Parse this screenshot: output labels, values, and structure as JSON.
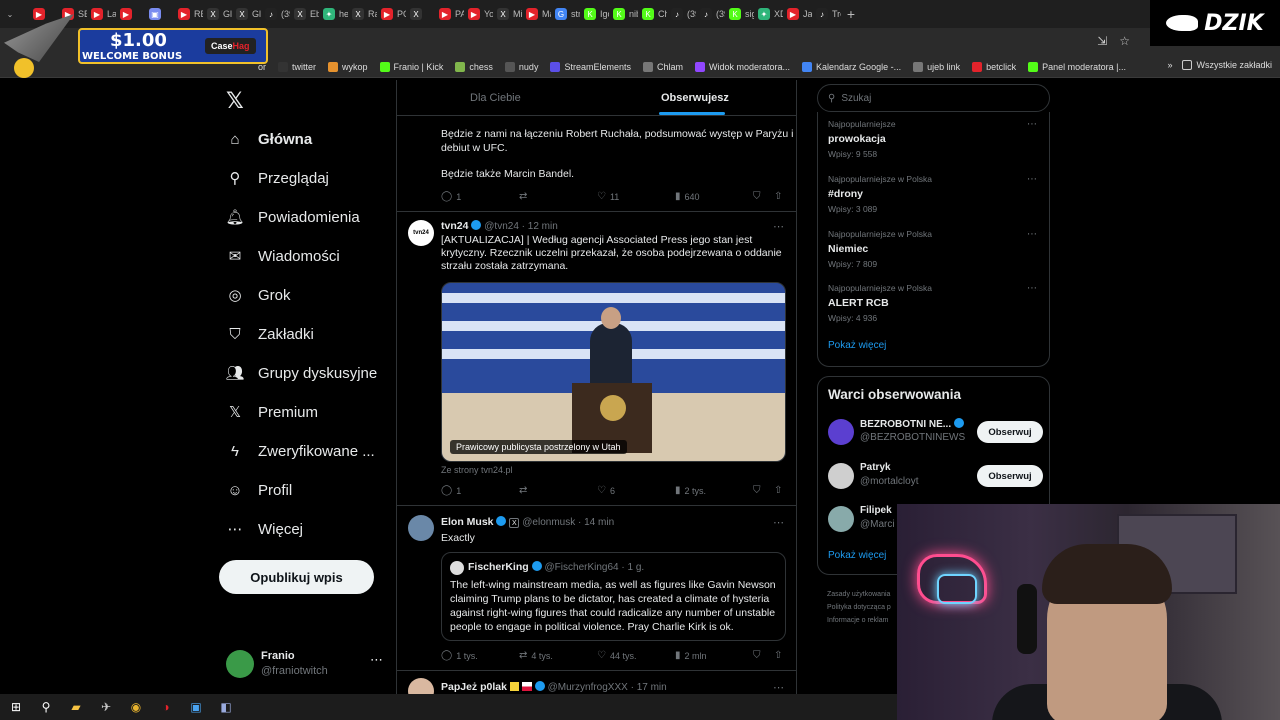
{
  "browser": {
    "tabs": [
      {
        "label": "",
        "color": "#e3232b",
        "glyph": "▶"
      },
      {
        "label": "SB",
        "color": "#e3232b",
        "glyph": "▶"
      },
      {
        "label": "Lau",
        "color": "#e3232b",
        "glyph": "▶"
      },
      {
        "label": "",
        "color": "#e3232b",
        "glyph": "▶"
      },
      {
        "label": "",
        "color": "#7a8cf0",
        "glyph": "▣"
      },
      {
        "label": "REI",
        "color": "#e3232b",
        "glyph": "▶"
      },
      {
        "label": "Glo",
        "color": "#333",
        "glyph": "X"
      },
      {
        "label": "Glo",
        "color": "#333",
        "glyph": "X"
      },
      {
        "label": "(39",
        "color": "#222",
        "glyph": "♪"
      },
      {
        "label": "Ebr",
        "color": "#333",
        "glyph": "X"
      },
      {
        "label": "hel",
        "color": "#2fb57a",
        "glyph": "✦"
      },
      {
        "label": "Ras",
        "color": "#333",
        "glyph": "X"
      },
      {
        "label": "PO",
        "color": "#e3232b",
        "glyph": "▶"
      },
      {
        "label": "",
        "color": "#333",
        "glyph": "X"
      },
      {
        "label": "PA",
        "color": "#e3232b",
        "glyph": "▶"
      },
      {
        "label": "You",
        "color": "#e3232b",
        "glyph": "▶"
      },
      {
        "label": "Mir",
        "color": "#333",
        "glyph": "X"
      },
      {
        "label": "Ma",
        "color": "#e3232b",
        "glyph": "▶"
      },
      {
        "label": "stra",
        "color": "#4285f4",
        "glyph": "G"
      },
      {
        "label": "Igo",
        "color": "#53fc18",
        "glyph": "K"
      },
      {
        "label": "nib",
        "color": "#53fc18",
        "glyph": "K"
      },
      {
        "label": "Ch",
        "color": "#53fc18",
        "glyph": "K"
      },
      {
        "label": "(39",
        "color": "#222",
        "glyph": "♪"
      },
      {
        "label": "(39",
        "color": "#222",
        "glyph": "♪"
      },
      {
        "label": "sig",
        "color": "#53fc18",
        "glyph": "K"
      },
      {
        "label": "XD",
        "color": "#2fb57a",
        "glyph": "✦"
      },
      {
        "label": "Jak",
        "color": "#e3232b",
        "glyph": "▶"
      },
      {
        "label": "Tre",
        "color": "#222",
        "glyph": "♪"
      }
    ],
    "new_tab": "+",
    "bookmarks": [
      {
        "label": "twitter",
        "color": "#333"
      },
      {
        "label": "wykop",
        "color": "#e6922e"
      },
      {
        "label": "Franio | Kick",
        "color": "#53fc18"
      },
      {
        "label": "chess",
        "color": "#81b64c"
      },
      {
        "label": "nudy",
        "color": "#555"
      },
      {
        "label": "StreamElements",
        "color": "#5b4fe8"
      },
      {
        "label": "Chlam",
        "color": "#777"
      },
      {
        "label": "Widok moderatora...",
        "color": "#9147ff"
      },
      {
        "label": "Kalendarz Google -...",
        "color": "#4285f4"
      },
      {
        "label": "ujeb link",
        "color": "#777"
      },
      {
        "label": "betclick",
        "color": "#e3232b"
      },
      {
        "label": "Panel moderatora |...",
        "color": "#53fc18"
      }
    ],
    "bookmarks_partial": "or",
    "all_bookmarks": "Wszystkie zakładki",
    "more_chevron": "»"
  },
  "ad": {
    "amount": "$1.00",
    "bonus": "WELCOME BONUS",
    "brand_a": "Case",
    "brand_b": "Hag"
  },
  "overlay_brand": "DZIK",
  "nav": {
    "items": [
      {
        "label": "Główna",
        "icon": "home-icon",
        "glyph": "⌂"
      },
      {
        "label": "Przeglądaj",
        "icon": "search-icon",
        "glyph": "⚲"
      },
      {
        "label": "Powiadomienia",
        "icon": "bell-icon",
        "glyph": "🔔︎"
      },
      {
        "label": "Wiadomości",
        "icon": "mail-icon",
        "glyph": "✉"
      },
      {
        "label": "Grok",
        "icon": "grok-icon",
        "glyph": "◎"
      },
      {
        "label": "Zakładki",
        "icon": "bookmark-icon",
        "glyph": "⛉"
      },
      {
        "label": "Grupy dyskusyjne",
        "icon": "communities-icon",
        "glyph": "👥︎"
      },
      {
        "label": "Premium",
        "icon": "x-premium-icon",
        "glyph": "𝕏"
      },
      {
        "label": "Zweryfikowane ...",
        "icon": "lightning-icon",
        "glyph": "ϟ"
      },
      {
        "label": "Profil",
        "icon": "profile-icon",
        "glyph": "☺"
      },
      {
        "label": "Więcej",
        "icon": "more-circle-icon",
        "glyph": "⋯"
      }
    ],
    "post_button": "Opublikuj wpis",
    "profile_name": "Franio",
    "profile_handle": "@franiotwitch",
    "profile_more": "⋯"
  },
  "feed": {
    "tab_for_you": "Dla Ciebie",
    "tab_following": "Obserwujesz",
    "post1": {
      "line1": "Będzie z nami na łączeniu Robert Ruchała, podsumować występ w Paryżu i",
      "line2": "debiut w UFC.",
      "line3": "Będzie także Marcin Bandel.",
      "replies": "1",
      "reposts": "",
      "likes": "11",
      "views": "640"
    },
    "post2": {
      "name": "tvn24",
      "handle": "@tvn24 · 12 min",
      "line1": "[AKTUALIZACJA] | Według agencji Associated Press jego stan jest",
      "line2": "krytyczny. Rzecznik uczelni przekazał, że osoba podejrzewana o oddanie",
      "line3": "strzału została zatrzymana.",
      "caption": "Prawicowy publicysta postrzelony w Utah",
      "source": "Ze strony tvn24.pl",
      "replies": "1",
      "reposts": "",
      "likes": "6",
      "views": "2 tys."
    },
    "post3": {
      "name": "Elon Musk",
      "handle": "@elonmusk · 14 min",
      "text": "Exactly",
      "quote_name": "FischerKing",
      "quote_handle": "@FischerKing64 · 1 g.",
      "quote_line1": "The left-wing mainstream media, as well as figures like Gavin Newson",
      "quote_line2": "claiming Trump plans to be dictator, has created a climate of hysteria",
      "quote_line3": "against right-wing figures that could radicalize any number of unstable",
      "quote_line4": "people to engage in political violence. Pray Charlie Kirk is ok.",
      "replies": "1 tys.",
      "reposts": "4 tys.",
      "likes": "44 tys.",
      "views": "2 mln"
    },
    "post4": {
      "name": "PapJeż p0lak",
      "handle": "@MurzynfrogXXX · 17 min"
    }
  },
  "right": {
    "search_placeholder": "Szukaj",
    "trends": [
      {
        "context": "Najpopularniejsze",
        "name": "prowokacja",
        "count": "Wpisy: 9 558"
      },
      {
        "context": "Najpopularniejsze w Polska",
        "name": "#drony",
        "count": "Wpisy: 3 089"
      },
      {
        "context": "Najpopularniejsze w Polska",
        "name": "Niemiec",
        "count": "Wpisy: 7 809"
      },
      {
        "context": "Najpopularniejsze w Polska",
        "name": "ALERT RCB",
        "count": "Wpisy: 4 936"
      }
    ],
    "show_more": "Pokaż więcej",
    "wtf_title": "Warci obserwowania",
    "wtf_users": [
      {
        "name": "BEZROBOTNI NE...",
        "handle": "@BEZROBOTNINEWS",
        "button": "Obserwuj",
        "color": "#5b3fd0"
      },
      {
        "name": "Patryk",
        "handle": "@mortalcloyt",
        "button": "Obserwuj",
        "color": "#cfcfcf"
      },
      {
        "name": "Filipek",
        "handle": "@Marci",
        "button": "",
        "color": "#8aa"
      }
    ],
    "wtf_show_more": "Pokaż więcej",
    "footer": [
      "Zasady użytkowania",
      "Polityka dotycząca p",
      "Informacje o reklam"
    ]
  },
  "taskbar": {
    "items": [
      {
        "name": "windows-start-icon",
        "glyph": "⊞",
        "color": "#ffffff"
      },
      {
        "name": "search-icon",
        "glyph": "⚲",
        "color": "#ffffff"
      },
      {
        "name": "file-explorer-icon",
        "glyph": "▰",
        "color": "#f6c343"
      },
      {
        "name": "app-icon",
        "glyph": "✈",
        "color": "#cccccc"
      },
      {
        "name": "chrome-icon",
        "glyph": "◉",
        "color": "#e8b32e"
      },
      {
        "name": "obs-icon",
        "glyph": "◑",
        "color": "#e3232b"
      },
      {
        "name": "app-icon-2",
        "glyph": "▣",
        "color": "#4aa3f0"
      },
      {
        "name": "app-icon-3",
        "glyph": "◧",
        "color": "#9ad"
      }
    ]
  }
}
